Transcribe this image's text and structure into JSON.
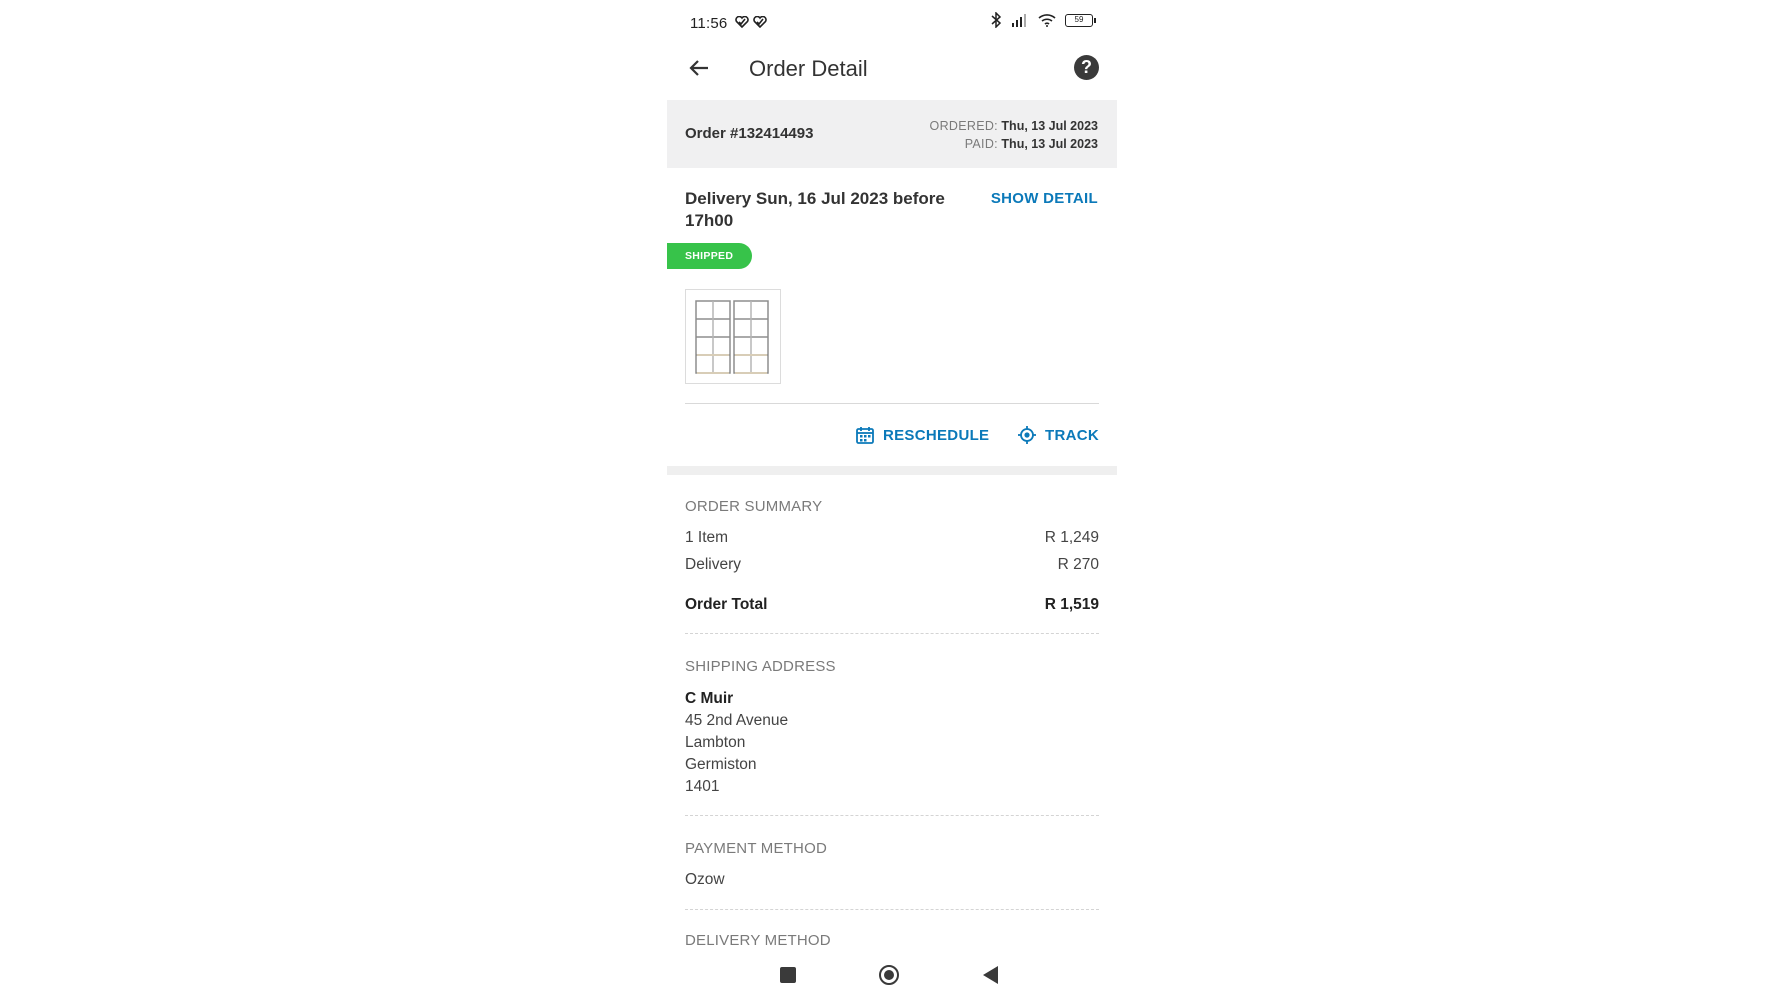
{
  "status_bar": {
    "time": "11:56",
    "battery": "59",
    "notif_icons": [
      "heart-check-icon",
      "heart-check-icon"
    ],
    "right_icons": [
      "bluetooth-icon",
      "signal-icon",
      "wifi-icon",
      "battery-icon"
    ]
  },
  "app_bar": {
    "title": "Order Detail",
    "back_icon": "back-arrow-icon",
    "help_icon": "help-icon",
    "help_glyph": "?"
  },
  "order": {
    "number": "Order #132414493",
    "ordered_label": "ORDERED:",
    "ordered_date": "Thu, 13 Jul 2023",
    "paid_label": "PAID:",
    "paid_date": "Thu, 13 Jul 2023"
  },
  "delivery": {
    "title": "Delivery Sun, 16 Jul 2023 before 17h00",
    "show_detail": "SHOW DETAIL",
    "status": "SHIPPED",
    "status_color": "#37c34a",
    "product_image": "shelving-unit-image",
    "reschedule": "RESCHEDULE",
    "track": "TRACK",
    "accent_color": "#0b79b9"
  },
  "summary": {
    "heading": "ORDER SUMMARY",
    "items_label": "1 Item",
    "items_value": "R 1,249",
    "delivery_label": "Delivery",
    "delivery_value": "R 270",
    "total_label": "Order Total",
    "total_value": "R 1,519"
  },
  "shipping": {
    "heading": "SHIPPING ADDRESS",
    "name": "C Muir",
    "line1": "45 2nd Avenue",
    "line2": "Lambton",
    "line3": "Germiston",
    "postcode": "1401"
  },
  "payment": {
    "heading": "PAYMENT METHOD",
    "method": "Ozow"
  },
  "delivery_method": {
    "heading": "DELIVERY METHOD"
  },
  "nav_bar": {
    "icons": [
      "recent-apps-icon",
      "home-icon",
      "back-icon"
    ]
  }
}
